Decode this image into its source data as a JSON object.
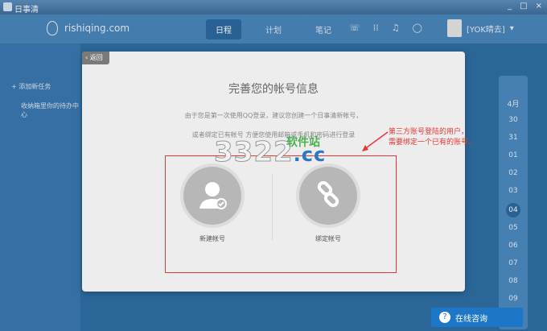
{
  "window": {
    "title": "日事清",
    "minimize": "_",
    "maximize": "□",
    "close": "×"
  },
  "app": {
    "logo": "rishiqing.com"
  },
  "nav": {
    "tabs": [
      "日程",
      "计划",
      "笔记"
    ]
  },
  "header": {
    "user": "[YOK晴去]"
  },
  "sidebar": {
    "add_task": "+ 添加新任务",
    "hint": "收纳箱里你的待办中心"
  },
  "calendar": {
    "month": "4月",
    "dates": [
      "30",
      "31",
      "01",
      "02",
      "03",
      "04",
      "05",
      "06",
      "07",
      "08",
      "09"
    ],
    "selected": "04"
  },
  "modal": {
    "back": "返回",
    "title": "完善您的帐号信息",
    "line1": "由于您是第一次使用QQ登录，建议您创建一个日事清新帐号，",
    "line2": "或者绑定已有帐号 方便您使用邮箱或手机和密码进行登录",
    "options": [
      {
        "label": "新建帐号",
        "icon": "user-check-icon"
      },
      {
        "label": "绑定帐号",
        "icon": "link-icon"
      }
    ]
  },
  "annotation": {
    "line1": "第三方账号登陆的用户，",
    "line2": "需要绑定一个已有的账号。"
  },
  "watermark": {
    "main": "3322",
    "suffix": ".cc",
    "sub": "软件站"
  },
  "chat": {
    "label": "在线咨询"
  },
  "colors": {
    "accent": "#1e76c6",
    "annotation": "#e53935"
  }
}
